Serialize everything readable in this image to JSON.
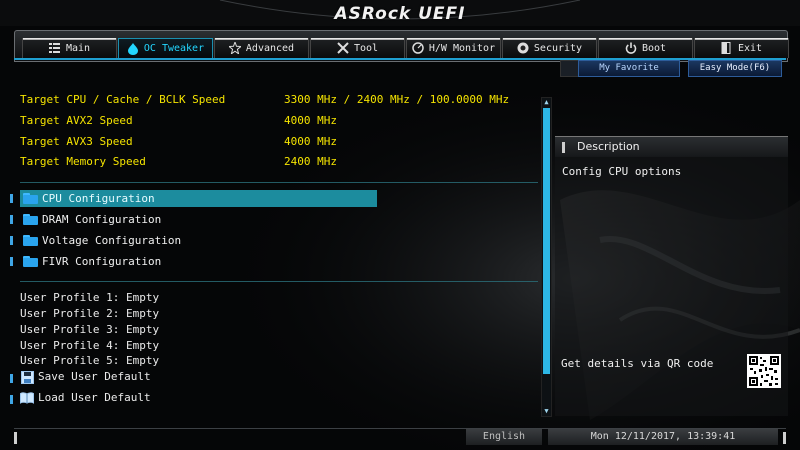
{
  "brand": {
    "logo_text": "ASRock UEFI"
  },
  "tabs": [
    {
      "label": "Main",
      "icon": "list-icon",
      "active": false
    },
    {
      "label": "OC Tweaker",
      "icon": "flame-icon",
      "active": true
    },
    {
      "label": "Advanced",
      "icon": "star-icon",
      "active": false
    },
    {
      "label": "Tool",
      "icon": "wrench-screwdriver-icon",
      "active": false
    },
    {
      "label": "H/W Monitor",
      "icon": "monitor-icon",
      "active": false
    },
    {
      "label": "Security",
      "icon": "shield-icon",
      "active": false
    },
    {
      "label": "Boot",
      "icon": "power-icon",
      "active": false
    },
    {
      "label": "Exit",
      "icon": "exit-door-icon",
      "active": false
    }
  ],
  "toolbar": {
    "favorite_label": "My Favorite",
    "easy_mode_label": "Easy Mode(F6)"
  },
  "targets": [
    {
      "label": "Target CPU / Cache / BCLK Speed",
      "value": "3300 MHz / 2400 MHz / 100.0000 MHz"
    },
    {
      "label": "Target AVX2 Speed",
      "value": "4000 MHz"
    },
    {
      "label": "Target AVX3 Speed",
      "value": "4000 MHz"
    },
    {
      "label": "Target Memory Speed",
      "value": "2400 MHz"
    }
  ],
  "menus": [
    {
      "label": "CPU Configuration",
      "selected": true
    },
    {
      "label": "DRAM Configuration",
      "selected": false
    },
    {
      "label": "Voltage Configuration",
      "selected": false
    },
    {
      "label": "FIVR Configuration",
      "selected": false
    }
  ],
  "profiles": [
    "User Profile 1: Empty",
    "User Profile 2: Empty",
    "User Profile 3: Empty",
    "User Profile 4: Empty",
    "User Profile 5: Empty"
  ],
  "actions": [
    {
      "label": "Save User Default",
      "icon": "floppy-disk-icon"
    },
    {
      "label": "Load User Default",
      "icon": "open-book-icon"
    }
  ],
  "description": {
    "title": "Description",
    "text": "Config CPU options",
    "qr_label": "Get details via QR code"
  },
  "status": {
    "language": "English",
    "datetime": "Mon 12/11/2017, 13:39:41"
  },
  "colors": {
    "accent": "#23d6ff",
    "value_yellow": "#f5e400",
    "selected_row": "#1c8c9e"
  }
}
